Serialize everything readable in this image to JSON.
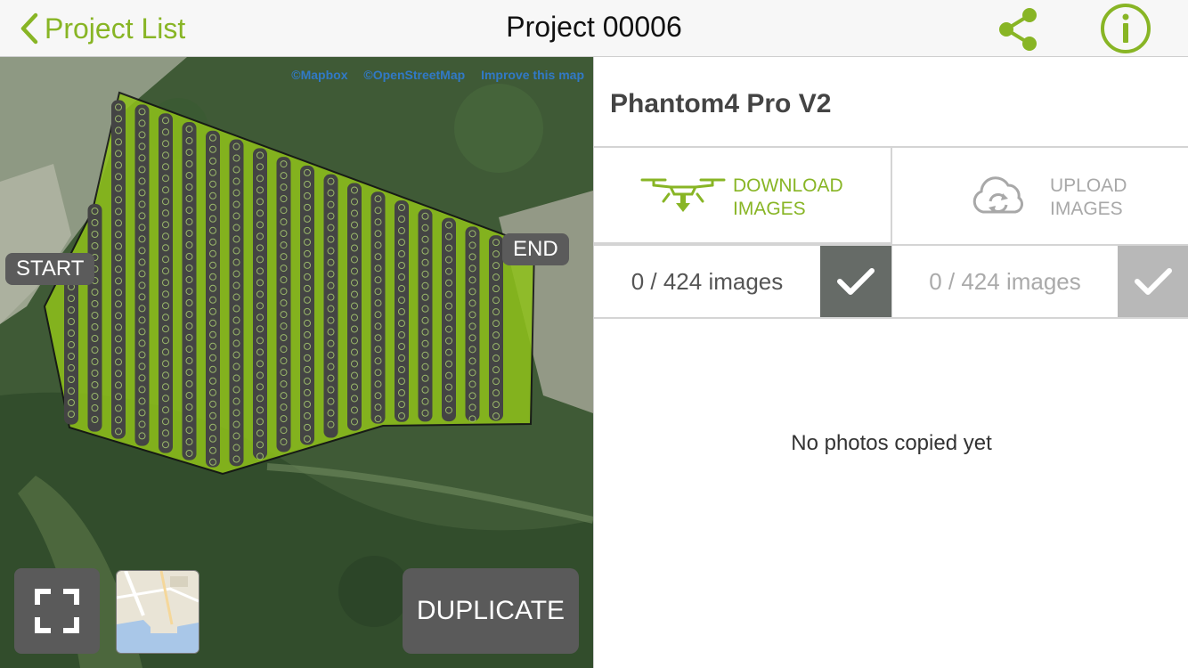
{
  "header": {
    "back_label": "Project List",
    "title": "Project 00006",
    "share_icon": "share-icon",
    "info_icon": "info-icon",
    "accent_color": "#88b525"
  },
  "map": {
    "attribution": [
      "©Mapbox",
      "©OpenStreetMap",
      "Improve this map"
    ],
    "start_label": "START",
    "end_label": "END",
    "fullscreen_icon": "fullscreen-icon",
    "duplicate_label": "DUPLICATE"
  },
  "panel": {
    "drone_name": "Phantom4 Pro V2",
    "download": {
      "label_line1": "DOWNLOAD",
      "label_line2": "IMAGES",
      "icon": "drone-download-icon",
      "count": "0 / 424 images",
      "progress": 0,
      "check_icon": "checkmark-icon"
    },
    "upload": {
      "label_line1": "UPLOAD",
      "label_line2": "IMAGES",
      "icon": "cloud-sync-icon",
      "count": "0 / 424 images",
      "check_icon": "checkmark-icon"
    },
    "empty_message": "No photos copied yet"
  }
}
